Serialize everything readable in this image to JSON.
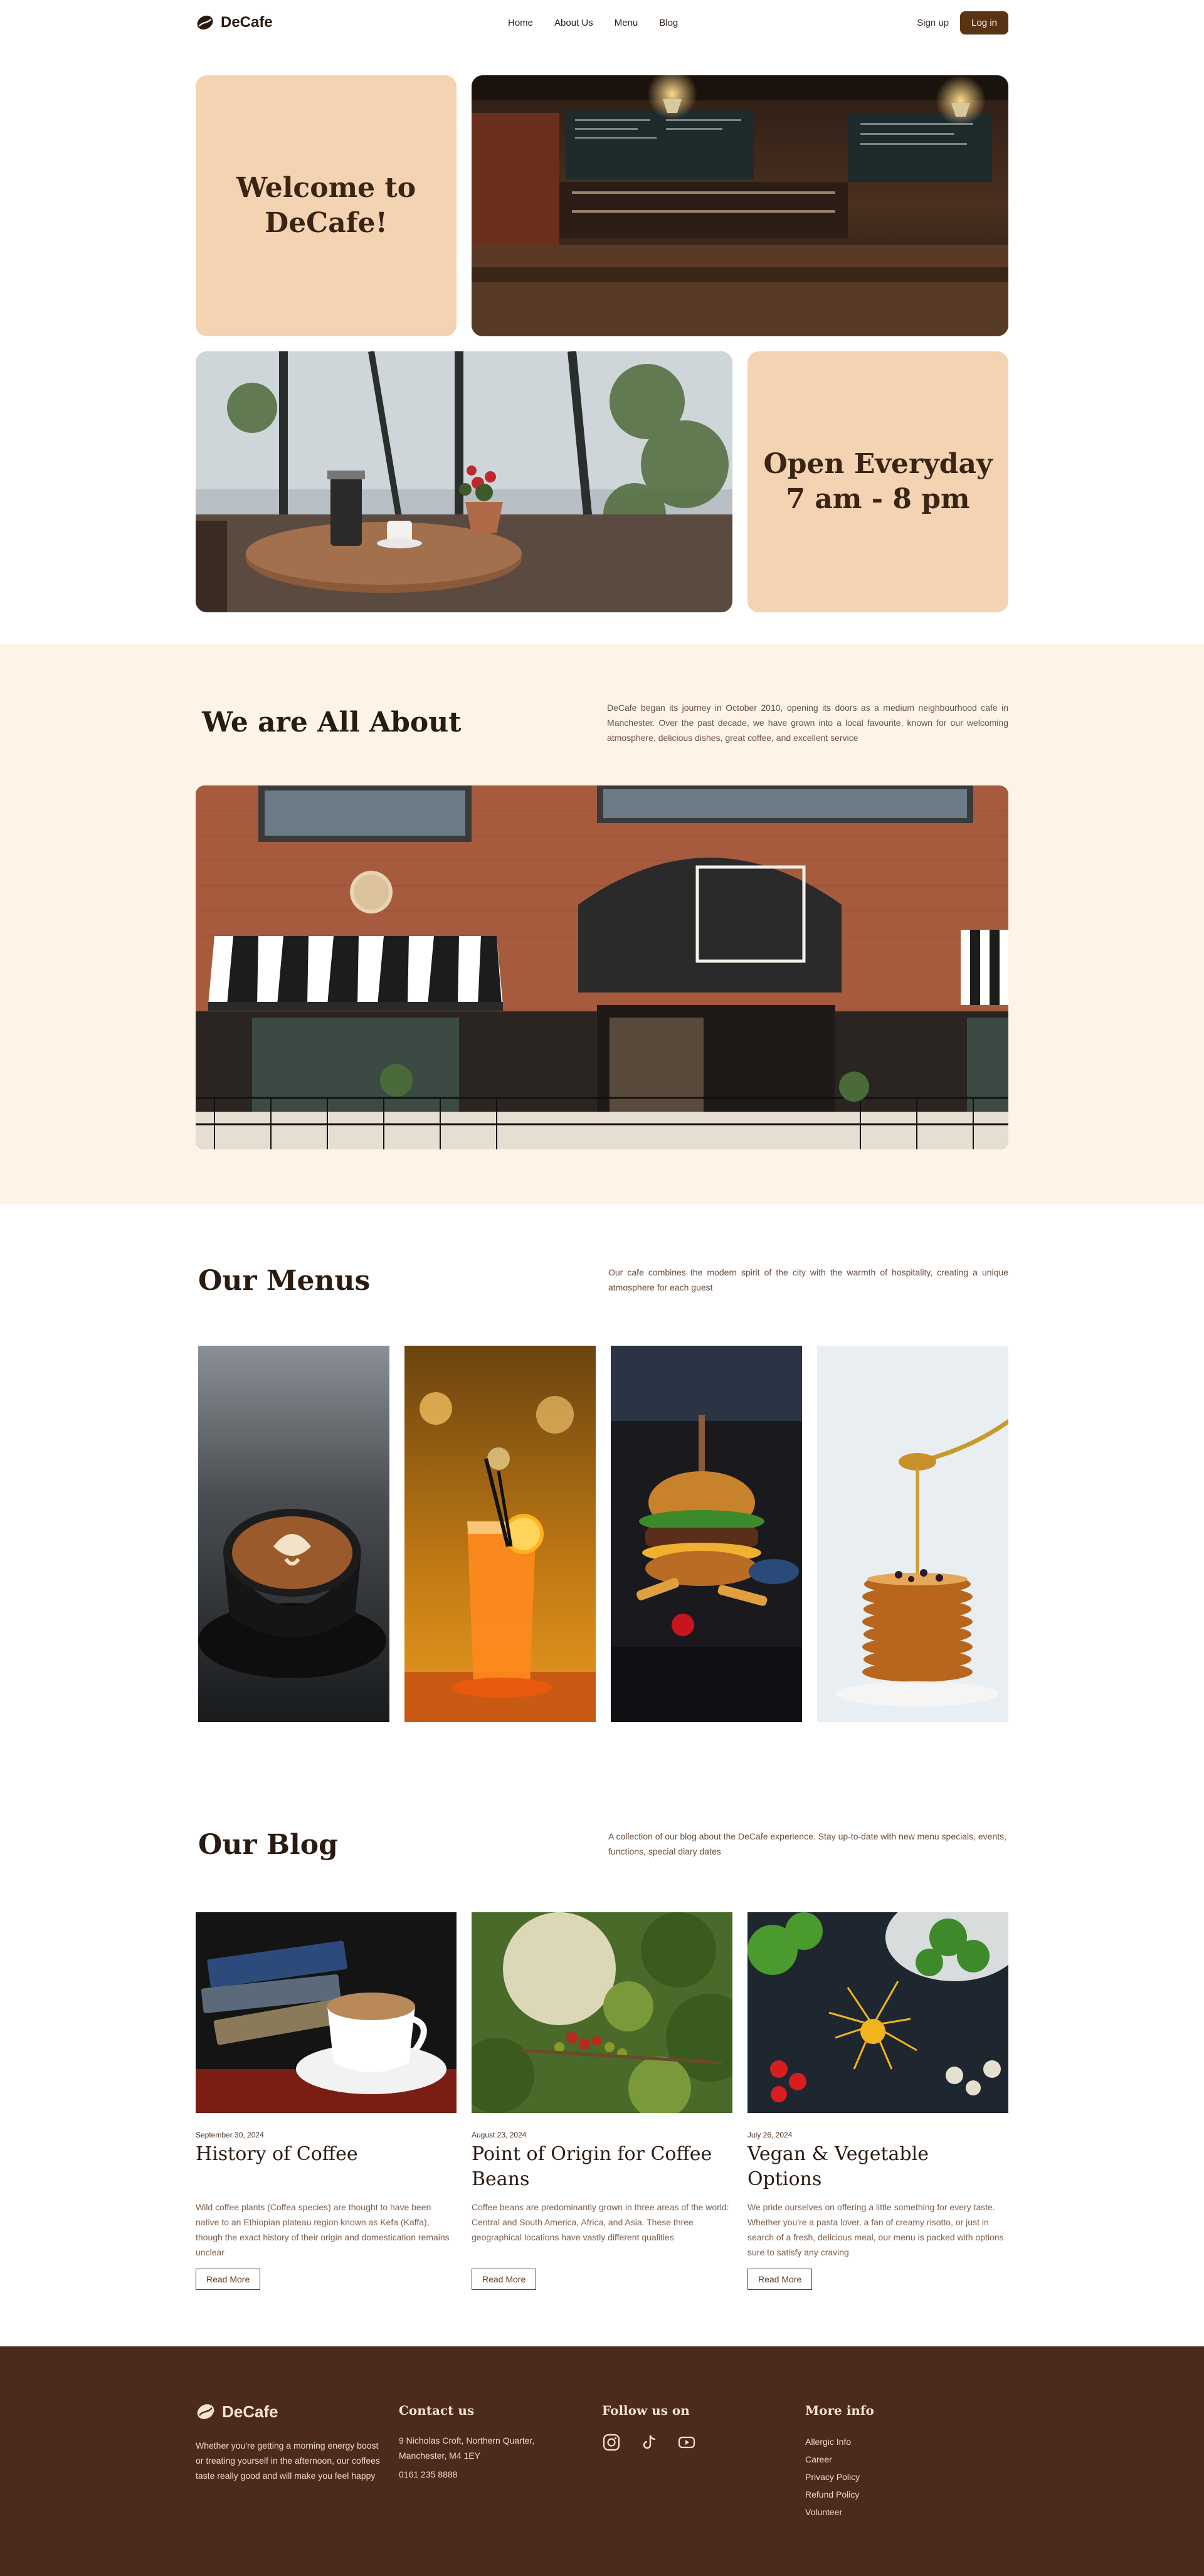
{
  "brand": {
    "name": "DeCafe"
  },
  "nav": {
    "items": [
      "Home",
      "About Us",
      "Menu",
      "Blog"
    ],
    "signup": "Sign up",
    "login": "Log in"
  },
  "hero": {
    "welcome": "Welcome to DeCafe!",
    "hours_line1": "Open Everyday",
    "hours_line2": "7 am - 8 pm"
  },
  "about": {
    "title": "We are All About",
    "text": "DeCafe began its journey in October 2010, opening its doors as a medium neighbourhood cafe in Manchester. Over the past decade, we have grown into a local favourite, known for our welcoming atmosphere, delicious dishes, great coffee, and excellent service"
  },
  "menus": {
    "title": "Our Menus",
    "text": "Our cafe combines the modern spirit of the city with the warmth of hospitality, creating a unique atmosphere for each guest"
  },
  "blog": {
    "title": "Our Blog",
    "text": "A collection of our blog about the DeCafe experience. Stay up-to-date with new menu specials, events, functions, special diary dates",
    "read_more": "Read More",
    "posts": [
      {
        "date": "September 30, 2024",
        "title": "History of Coffee",
        "excerpt": "Wild coffee plants (Coffea species) are thought to have been native to an Ethiopian plateau region known as Kefa (Kaffa), though the exact history of their origin and domestication remains unclear"
      },
      {
        "date": "August 23, 2024",
        "title": "Point of Origin for Coffee Beans",
        "excerpt": "Coffee beans are predominantly grown in three areas of the world: Central and South America, Africa, and Asia. These three geographical locations have vastly different qualities"
      },
      {
        "date": "July 26, 2024",
        "title": "Vegan & Vegetable Options",
        "excerpt": "We pride ourselves on offering a little something for every taste. Whether you're a pasta lover, a fan of creamy risotto, or just in search of a fresh, delicious meal, our menu is packed with options sure to satisfy any craving"
      }
    ]
  },
  "footer": {
    "tagline": "Whether you're getting a morning energy boost or treating yourself in the afternoon, our coffees taste really good and will make you feel happy",
    "contact_title": "Contact us",
    "address": "9 Nicholas Croft, Northern Quarter, Manchester, M4 1EY",
    "phone": "0161 235 8888",
    "follow_title": "Follow us on",
    "social_icons": [
      "instagram-icon",
      "tiktok-icon",
      "youtube-icon"
    ],
    "more_title": "More info",
    "links": [
      "Allergic Info",
      "Career",
      "Privacy Policy",
      "Refund Policy",
      "Volunteer"
    ]
  },
  "colors": {
    "accent": "#5a3312",
    "peach": "#f3d3b1",
    "cream": "#fdf3e7",
    "footer": "#4c2a1c"
  }
}
